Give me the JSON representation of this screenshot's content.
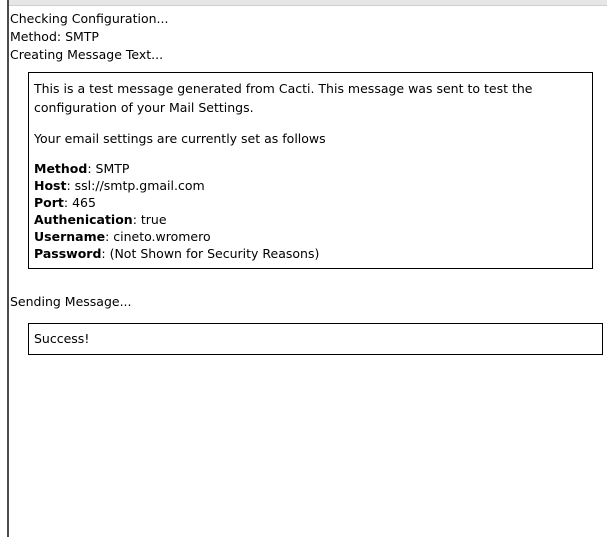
{
  "log": {
    "checking": "Checking Configuration...",
    "method": "Method: SMTP",
    "creating": "Creating Message Text..."
  },
  "message": {
    "intro": "This is a test message generated from Cacti. This message was sent to test the configuration of your Mail Settings.",
    "settings_heading": "Your email settings are currently set as follows",
    "fields": [
      {
        "label": "Method",
        "value": ": SMTP"
      },
      {
        "label": "Host",
        "value": ": ssl://smtp.gmail.com"
      },
      {
        "label": "Port",
        "value": ": 465"
      },
      {
        "label": "Authenication",
        "value": ": true"
      },
      {
        "label": "Username",
        "value": ": cineto.wromero"
      },
      {
        "label": "Password",
        "value": ": (Not Shown for Security Reasons)"
      }
    ]
  },
  "sending": "Sending Message...",
  "result": "Success!"
}
